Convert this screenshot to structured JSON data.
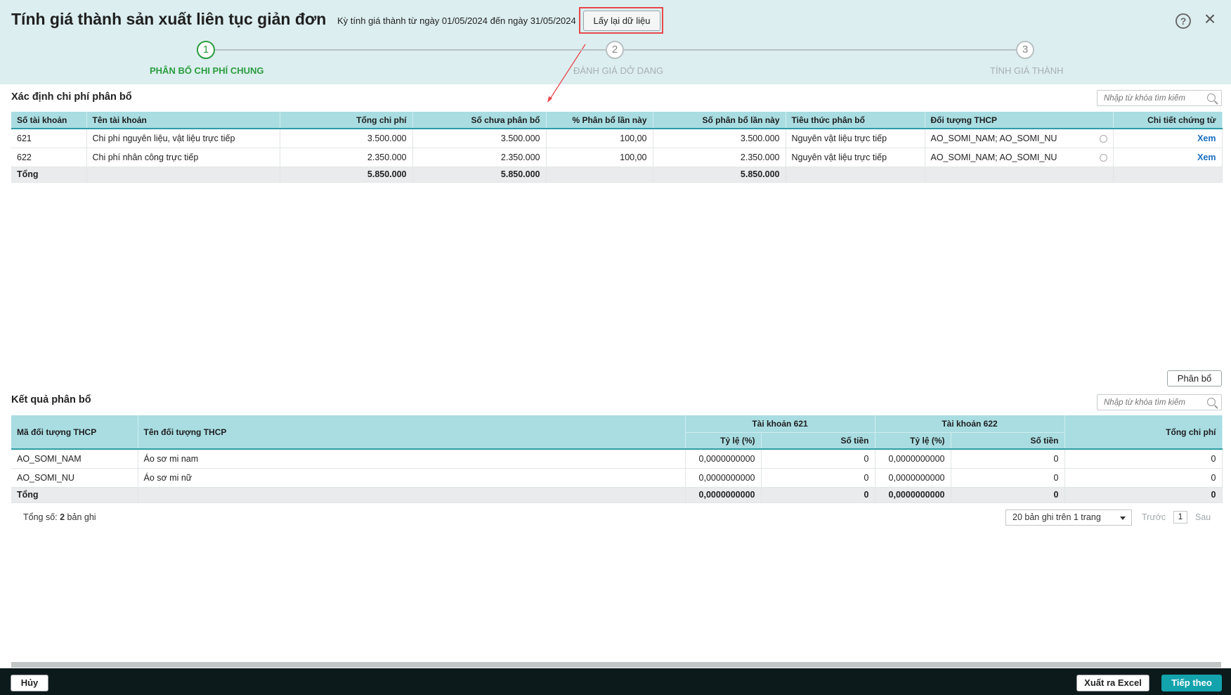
{
  "header": {
    "title": "Tính giá thành sản xuất liên tục giản đơn",
    "period": "Kỳ tính giá thành từ ngày 01/05/2024 đến ngày 31/05/2024",
    "reload_label": "Lấy lại dữ liệu",
    "help_icon": "question-circle-icon",
    "close_icon": "close-icon"
  },
  "steps": [
    {
      "number": "1",
      "label": "PHÂN BỔ CHI PHÍ CHUNG",
      "active": true
    },
    {
      "number": "2",
      "label": "ĐÁNH GIÁ DỞ DANG",
      "active": false
    },
    {
      "number": "3",
      "label": "TÍNH GIÁ THÀNH",
      "active": false
    }
  ],
  "allocation": {
    "title": "Xác định chi phí phân bổ",
    "search_placeholder": "Nhập từ khóa tìm kiếm",
    "columns": [
      "Số tài khoản",
      "Tên tài khoản",
      "Tổng chi phí",
      "Số chưa phân bổ",
      "% Phân bổ lần này",
      "Số phân bổ lần này",
      "Tiêu thức phân bổ",
      "Đối tượng THCP",
      "Chi tiết chứng từ"
    ],
    "rows": [
      {
        "account": "621",
        "name": "Chi phí nguyên liệu, vật liệu trực tiếp",
        "total": "3.500.000",
        "unallocated": "3.500.000",
        "percent": "100,00",
        "allocated": "3.500.000",
        "criteria": "Nguyên vật liệu trực tiếp",
        "objects": "AO_SOMI_NAM; AO_SOMI_NU",
        "detail": "Xem"
      },
      {
        "account": "622",
        "name": "Chi phí nhân công trực tiếp",
        "total": "2.350.000",
        "unallocated": "2.350.000",
        "percent": "100,00",
        "allocated": "2.350.000",
        "criteria": "Nguyên vật liệu trực tiếp",
        "objects": "AO_SOMI_NAM; AO_SOMI_NU",
        "detail": "Xem"
      }
    ],
    "total_row": {
      "label": "Tổng",
      "total": "5.850.000",
      "unallocated": "5.850.000",
      "allocated": "5.850.000"
    },
    "allocate_button": "Phân bổ"
  },
  "result": {
    "title": "Kết quả phân bổ",
    "search_placeholder": "Nhập từ khóa tìm kiếm",
    "columns": {
      "code": "Mã đối tượng THCP",
      "name": "Tên đối tượng THCP",
      "acc621": "Tài khoản 621",
      "acc622": "Tài khoản 622",
      "ratio": "Tỷ lệ (%)",
      "amount": "Số tiền",
      "total": "Tổng chi phí"
    },
    "rows": [
      {
        "code": "AO_SOMI_NAM",
        "name": "Áo sơ mi nam",
        "r621": "0,0000000000",
        "a621": "0",
        "r622": "0,0000000000",
        "a622": "0",
        "total": "0"
      },
      {
        "code": "AO_SOMI_NU",
        "name": "Áo sơ mi nữ",
        "r621": "0,0000000000",
        "a621": "0",
        "r622": "0,0000000000",
        "a622": "0",
        "total": "0"
      }
    ],
    "total_row": {
      "label": "Tổng",
      "r621": "0,0000000000",
      "a621": "0",
      "r622": "0,0000000000",
      "a622": "0",
      "total": "0"
    }
  },
  "pagination": {
    "count_prefix": "Tổng số: ",
    "count": "2",
    "count_suffix": " bản ghi",
    "page_size": "20 bản ghi trên 1 trang",
    "prev": "Trước",
    "page": "1",
    "next": "Sau"
  },
  "footer": {
    "cancel": "Hủy",
    "export": "Xuất ra Excel",
    "next": "Tiếp theo"
  },
  "colors": {
    "header_bg": "#dceef0",
    "table_header": "#a9dde2",
    "active_step": "#2a9d3e",
    "primary_button": "#13a3ad",
    "highlight": "#e8474a",
    "link": "#1a6fbf"
  }
}
